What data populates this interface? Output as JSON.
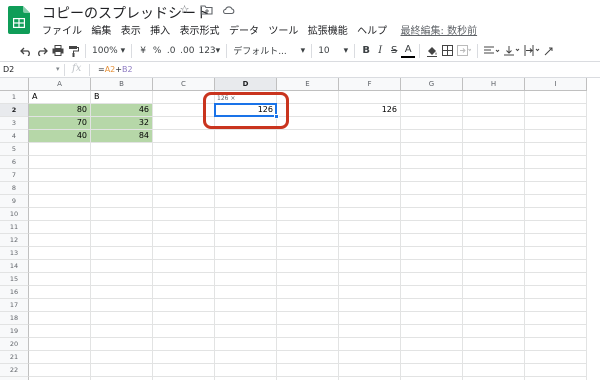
{
  "app": {
    "doc_title": "コピーのスプレッドシート",
    "menu": [
      "ファイル",
      "編集",
      "表示",
      "挿入",
      "表示形式",
      "データ",
      "ツール",
      "拡張機能",
      "ヘルプ"
    ],
    "last_edit": "最終編集: 数秒前",
    "title_icons": [
      "star-icon",
      "folder-icon",
      "cloud-icon"
    ]
  },
  "toolbar": {
    "zoom": "100%",
    "currency": "¥",
    "percent": "%",
    "dec_decrease": ".0",
    "dec_increase": ".00",
    "more_formats": "123",
    "font": "デフォルト...",
    "font_size": "10",
    "bold": "B",
    "italic": "I",
    "strike": "S",
    "text_color": "A"
  },
  "formula_bar": {
    "name_box": "D2",
    "fx": "fx",
    "formula_prefix": "=",
    "ref_a": "A2",
    "op": "+",
    "ref_b": "B2"
  },
  "grid": {
    "columns": [
      "A",
      "B",
      "C",
      "D",
      "E",
      "F",
      "G",
      "H",
      "I"
    ],
    "rows": [
      "1",
      "2",
      "3",
      "4",
      "5",
      "6",
      "7",
      "8",
      "9",
      "10",
      "11",
      "12",
      "13",
      "14",
      "15",
      "16",
      "17",
      "18",
      "19",
      "20",
      "21",
      "22",
      "23"
    ],
    "active_cell": "D2",
    "cells": {
      "A1": "A",
      "B1": "B",
      "A2": "80",
      "B2": "46",
      "A3": "70",
      "B3": "32",
      "A4": "40",
      "B4": "84",
      "D2": "126",
      "F2": "126"
    },
    "tooltip": "126 ×",
    "colors": {
      "fill_green": "#b6d7a8",
      "selection_blue": "#1a73e8",
      "annotation_red": "#c9341e"
    }
  }
}
